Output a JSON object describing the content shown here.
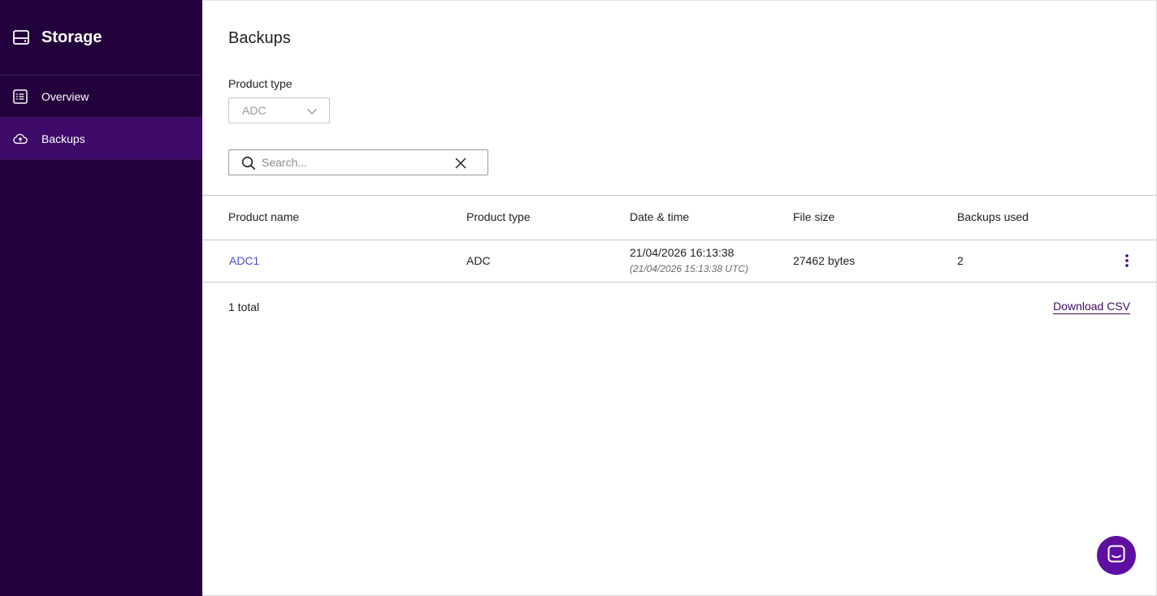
{
  "sidebar": {
    "title": "Storage",
    "title_icon": "storage-drive-icon",
    "items": [
      {
        "label": "Overview",
        "icon": "list-icon",
        "active": false
      },
      {
        "label": "Backups",
        "icon": "cloud-upload-icon",
        "active": true
      }
    ]
  },
  "main": {
    "title": "Backups",
    "product_type": {
      "label": "Product type",
      "selected": "ADC"
    },
    "search": {
      "placeholder": "Search...",
      "value": ""
    },
    "table": {
      "columns": [
        "Product name",
        "Product type",
        "Date & time",
        "File size",
        "Backups used"
      ],
      "rows": [
        {
          "product_name": "ADC1",
          "product_type": "ADC",
          "date_time": "21/04/2026 16:13:38",
          "date_time_utc": "(21/04/2026 15:13:38 UTC)",
          "file_size": "27462 bytes",
          "backups_used": "2"
        }
      ]
    },
    "footer": {
      "total": "1 total",
      "download_label": "Download CSV"
    }
  },
  "colors": {
    "sidebar_bg": "#22003c",
    "sidebar_active": "#3e0a6a",
    "accent": "#5e0fa0",
    "link": "#4a4ad0"
  }
}
